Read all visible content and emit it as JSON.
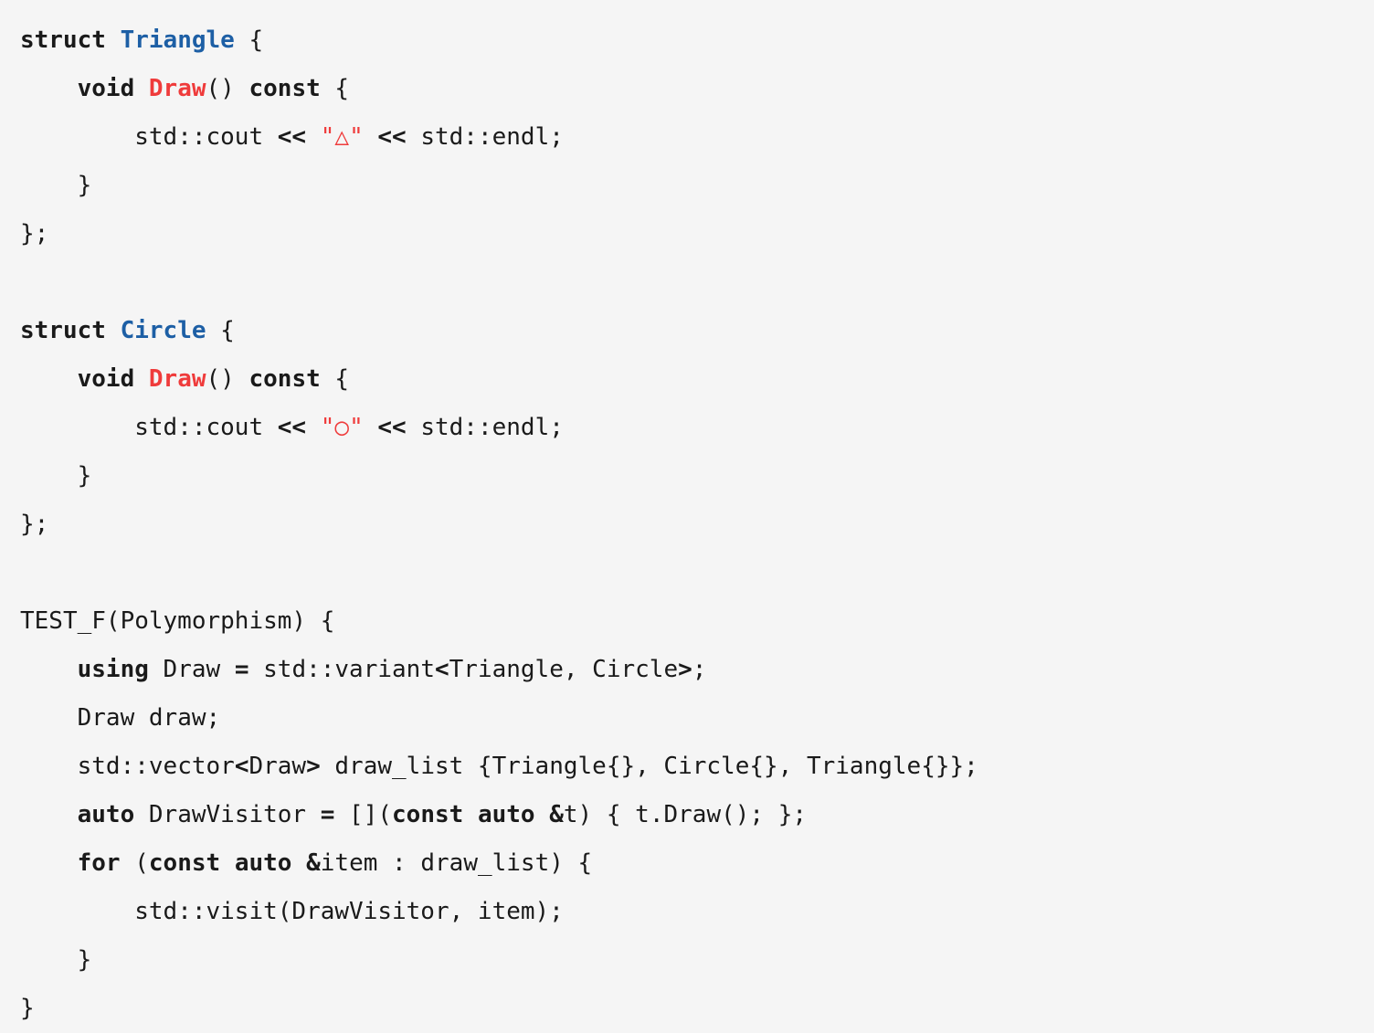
{
  "editor": {
    "language": "cpp",
    "background_color": "#f5f5f5",
    "default_text_color": "#1a1a1a",
    "indent_unit": "    "
  },
  "theme": {
    "keyword_color": "#1a1a1a",
    "type_color": "#1d5fa5",
    "function_color": "#ef3b3b",
    "string_color": "#ef3b3b",
    "operator_color": "#1a1a1a",
    "plain_color": "#1a1a1a"
  },
  "glyphs": {
    "triangle": "△",
    "circle": "○"
  },
  "code": {
    "lines": [
      {
        "indent": 0,
        "tokens": [
          {
            "t": "struct",
            "k": "kw"
          },
          {
            "t": " ",
            "k": "plain"
          },
          {
            "t": "Triangle",
            "k": "type"
          },
          {
            "t": " {",
            "k": "plain"
          }
        ]
      },
      {
        "indent": 1,
        "tokens": [
          {
            "t": "void",
            "k": "kw"
          },
          {
            "t": " ",
            "k": "plain"
          },
          {
            "t": "Draw",
            "k": "fn"
          },
          {
            "t": "() ",
            "k": "plain"
          },
          {
            "t": "const",
            "k": "kw"
          },
          {
            "t": " {",
            "k": "plain"
          }
        ]
      },
      {
        "indent": 2,
        "tokens": [
          {
            "t": "std::cout ",
            "k": "plain"
          },
          {
            "t": "<<",
            "k": "op"
          },
          {
            "t": " ",
            "k": "plain"
          },
          {
            "t": "\"",
            "k": "str"
          },
          {
            "t": "△",
            "k": "shape"
          },
          {
            "t": "\"",
            "k": "str"
          },
          {
            "t": " ",
            "k": "plain"
          },
          {
            "t": "<<",
            "k": "op"
          },
          {
            "t": " std::endl;",
            "k": "plain"
          }
        ]
      },
      {
        "indent": 1,
        "tokens": [
          {
            "t": "}",
            "k": "plain"
          }
        ]
      },
      {
        "indent": 0,
        "tokens": [
          {
            "t": "};",
            "k": "plain"
          }
        ]
      },
      {
        "indent": 0,
        "blank": true,
        "tokens": []
      },
      {
        "indent": 0,
        "tokens": [
          {
            "t": "struct",
            "k": "kw"
          },
          {
            "t": " ",
            "k": "plain"
          },
          {
            "t": "Circle",
            "k": "type"
          },
          {
            "t": " {",
            "k": "plain"
          }
        ]
      },
      {
        "indent": 1,
        "tokens": [
          {
            "t": "void",
            "k": "kw"
          },
          {
            "t": " ",
            "k": "plain"
          },
          {
            "t": "Draw",
            "k": "fn"
          },
          {
            "t": "() ",
            "k": "plain"
          },
          {
            "t": "const",
            "k": "kw"
          },
          {
            "t": " {",
            "k": "plain"
          }
        ]
      },
      {
        "indent": 2,
        "tokens": [
          {
            "t": "std::cout ",
            "k": "plain"
          },
          {
            "t": "<<",
            "k": "op"
          },
          {
            "t": " ",
            "k": "plain"
          },
          {
            "t": "\"",
            "k": "str"
          },
          {
            "t": "○",
            "k": "shape"
          },
          {
            "t": "\"",
            "k": "str"
          },
          {
            "t": " ",
            "k": "plain"
          },
          {
            "t": "<<",
            "k": "op"
          },
          {
            "t": " std::endl;",
            "k": "plain"
          }
        ]
      },
      {
        "indent": 1,
        "tokens": [
          {
            "t": "}",
            "k": "plain"
          }
        ]
      },
      {
        "indent": 0,
        "tokens": [
          {
            "t": "};",
            "k": "plain"
          }
        ]
      },
      {
        "indent": 0,
        "blank": true,
        "tokens": []
      },
      {
        "indent": 0,
        "tokens": [
          {
            "t": "TEST_F(Polymorphism) {",
            "k": "plain"
          }
        ]
      },
      {
        "indent": 1,
        "tokens": [
          {
            "t": "using",
            "k": "kw"
          },
          {
            "t": " Draw ",
            "k": "plain"
          },
          {
            "t": "=",
            "k": "op"
          },
          {
            "t": " std::variant",
            "k": "plain"
          },
          {
            "t": "<",
            "k": "op"
          },
          {
            "t": "Triangle, Circle",
            "k": "plain"
          },
          {
            "t": ">",
            "k": "op"
          },
          {
            "t": ";",
            "k": "plain"
          }
        ]
      },
      {
        "indent": 1,
        "tokens": [
          {
            "t": "Draw draw;",
            "k": "plain"
          }
        ]
      },
      {
        "indent": 1,
        "tokens": [
          {
            "t": "std::vector",
            "k": "plain"
          },
          {
            "t": "<",
            "k": "op"
          },
          {
            "t": "Draw",
            "k": "plain"
          },
          {
            "t": ">",
            "k": "op"
          },
          {
            "t": " draw_list {Triangle{}, Circle{}, Triangle{}};",
            "k": "plain"
          }
        ]
      },
      {
        "indent": 1,
        "tokens": [
          {
            "t": "auto",
            "k": "kw"
          },
          {
            "t": " DrawVisitor ",
            "k": "plain"
          },
          {
            "t": "=",
            "k": "op"
          },
          {
            "t": " [](",
            "k": "plain"
          },
          {
            "t": "const",
            "k": "kw"
          },
          {
            "t": " ",
            "k": "plain"
          },
          {
            "t": "auto",
            "k": "kw"
          },
          {
            "t": " ",
            "k": "plain"
          },
          {
            "t": "&",
            "k": "op"
          },
          {
            "t": "t) { t.Draw(); };",
            "k": "plain"
          }
        ]
      },
      {
        "indent": 1,
        "tokens": [
          {
            "t": "for",
            "k": "kw"
          },
          {
            "t": " (",
            "k": "plain"
          },
          {
            "t": "const",
            "k": "kw"
          },
          {
            "t": " ",
            "k": "plain"
          },
          {
            "t": "auto",
            "k": "kw"
          },
          {
            "t": " ",
            "k": "plain"
          },
          {
            "t": "&",
            "k": "op"
          },
          {
            "t": "item : draw_list) {",
            "k": "plain"
          }
        ]
      },
      {
        "indent": 2,
        "tokens": [
          {
            "t": "std::visit(DrawVisitor, item);",
            "k": "plain"
          }
        ]
      },
      {
        "indent": 1,
        "tokens": [
          {
            "t": "}",
            "k": "plain"
          }
        ]
      },
      {
        "indent": 0,
        "tokens": [
          {
            "t": "}",
            "k": "plain"
          }
        ]
      }
    ]
  }
}
